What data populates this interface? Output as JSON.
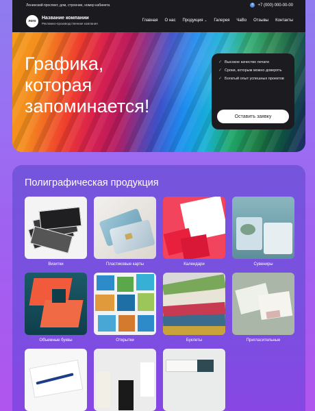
{
  "header": {
    "address": "Ленинский проспект, дом, строение, номер кабинета",
    "phone": "+7 (000) 000-00-00",
    "logo": "лого",
    "company_name": "Название компании",
    "company_subtitle": "Рекламно-производственная компания",
    "nav": [
      "Главная",
      "О нас",
      "Продукция",
      "Галерея",
      "ЧаВо",
      "Отзывы",
      "Контакты"
    ]
  },
  "hero": {
    "title_lines": [
      "Графика,",
      "которая",
      "запоминается!"
    ],
    "features": [
      "Высокое качество печати",
      "Сроки, которым можно доверять",
      "Богатый опыт успешных проектов"
    ],
    "cta": "Оставить заявку"
  },
  "products": {
    "title": "Полиграфическая продукция",
    "items": [
      "Визитки",
      "Пластиковые карты",
      "Календари",
      "Сувениры",
      "Объемные буквы",
      "Открытки",
      "Буклеты",
      "Пригласительные",
      "",
      "",
      ""
    ]
  }
}
